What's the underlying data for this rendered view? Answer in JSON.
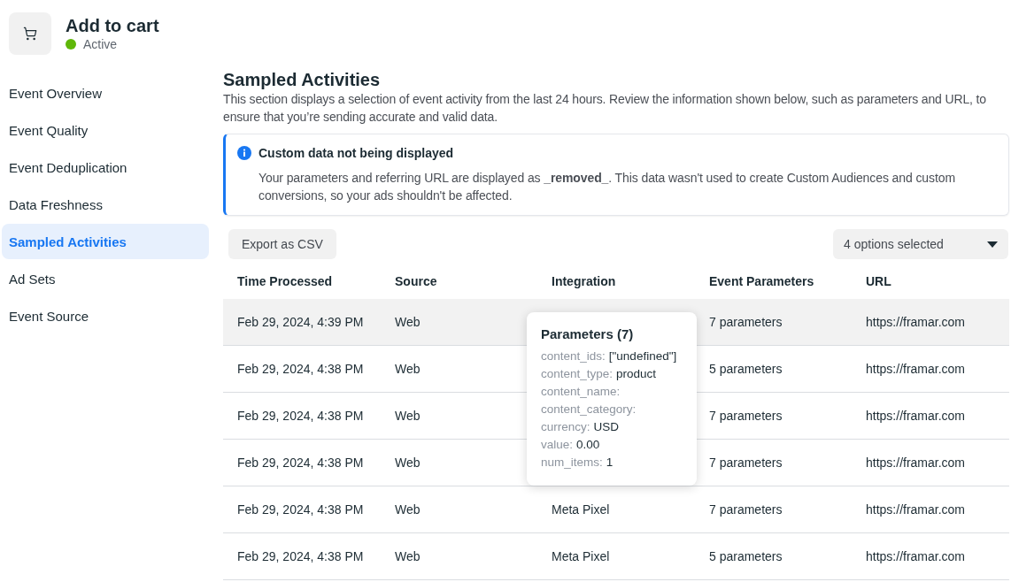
{
  "event": {
    "title": "Add to cart",
    "status": {
      "label": "Active",
      "on": true
    }
  },
  "sidebar": {
    "items": [
      {
        "label": "Event Overview",
        "selected": false
      },
      {
        "label": "Event Quality",
        "selected": false
      },
      {
        "label": "Event Deduplication",
        "selected": false
      },
      {
        "label": "Data Freshness",
        "selected": false
      },
      {
        "label": "Sampled Activities",
        "selected": true
      },
      {
        "label": "Ad Sets",
        "selected": false
      },
      {
        "label": "Event Source",
        "selected": false
      }
    ]
  },
  "section": {
    "title": "Sampled Activities",
    "description": "This section displays a selection of event activity from the last 24 hours. Review the information shown below, such as parameters and URL, to ensure that you’re sending accurate and valid data."
  },
  "notice": {
    "title": "Custom data not being displayed",
    "body": "Your parameters and referring URL are displayed as **_removed_**. This data wasn't used to create Custom Audiences and custom conversions, so your ads shouldn't be affected."
  },
  "toolbar": {
    "export_button": "Export as CSV",
    "filter": {
      "value": "4 options selected"
    }
  },
  "table": {
    "columns": [
      "Time Processed",
      "Source",
      "Integration",
      "Event Parameters",
      "URL"
    ],
    "rows": [
      {
        "time": "Feb 29, 2024, 4:39 PM",
        "source": "Web",
        "event_parameters": "7 parameters",
        "url": "https://framar.com",
        "highlighted": true
      },
      {
        "time": "Feb 29, 2024, 4:38 PM",
        "source": "Web",
        "event_parameters": "5 parameters",
        "url": "https://framar.com",
        "highlighted": false
      },
      {
        "time": "Feb 29, 2024, 4:38 PM",
        "source": "Web",
        "event_parameters": "7 parameters",
        "url": "https://framar.com",
        "highlighted": false
      },
      {
        "time": "Feb 29, 2024, 4:38 PM",
        "source": "Web",
        "event_parameters": "7 parameters",
        "url": "https://framar.com",
        "highlighted": false
      },
      {
        "time": "Feb 29, 2024, 4:38 PM",
        "source": "Web",
        "integration": "Meta Pixel",
        "event_parameters": "7 parameters",
        "url": "https://framar.com",
        "highlighted": false
      },
      {
        "time": "Feb 29, 2024, 4:38 PM",
        "source": "Web",
        "integration": "Meta Pixel",
        "event_parameters": "5 parameters",
        "url": "https://framar.com",
        "highlighted": false
      }
    ],
    "parameters_popover": {
      "title": "Parameters (7)",
      "items": [
        {
          "name": "content_ids:",
          "value": "[\"undefined\"]"
        },
        {
          "name": "content_type:",
          "value": "product"
        },
        {
          "name": "content_name:"
        },
        {
          "name": "content_category:"
        },
        {
          "name": "currency:",
          "value": "USD"
        },
        {
          "name": "value:",
          "value": "0.00"
        },
        {
          "name": "num_items:",
          "value": "1"
        }
      ]
    }
  }
}
